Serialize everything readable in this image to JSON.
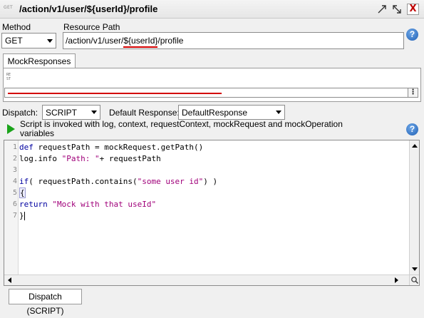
{
  "titlebar": {
    "method_badge": "GET",
    "title": "/action/v1/user/${userId}/profile",
    "close_label": "X"
  },
  "method": {
    "label": "Method",
    "value": "GET"
  },
  "resource_path": {
    "label": "Resource Path",
    "prefix": "/action/v1/user/",
    "param": "${userId}",
    "suffix": "/profile"
  },
  "mock_panel": {
    "tab_label": "MockResponses",
    "rest_icon_text": "RE ST"
  },
  "dispatch": {
    "label": "Dispatch:",
    "value": "SCRIPT",
    "default_response_label": "Default Response:",
    "default_response_value": "DefaultResponse"
  },
  "script_info": {
    "line1": "Script is invoked with log, context, requestContext, mockRequest and mockOperation",
    "line2": "variables"
  },
  "editor": {
    "line_numbers": [
      "1",
      "2",
      "3",
      "4",
      "5",
      "6",
      "7"
    ],
    "lines": [
      {
        "kw": "def",
        "code": " requestPath = mockRequest.getPath()",
        "str": ""
      },
      {
        "kw": "",
        "code": "log.info ",
        "str": "\"Path: \"",
        "rest": "+ requestPath"
      },
      {
        "kw": "",
        "code": "",
        "str": ""
      },
      {
        "kw": "if",
        "code": "( requestPath.contains(",
        "str": "\"some user id\"",
        "rest": ") )"
      },
      {
        "kw": "",
        "code": "{",
        "str": ""
      },
      {
        "kw": "return",
        "code": " ",
        "str": "\"Mock with that useId\""
      },
      {
        "kw": "",
        "code": "}",
        "str": ""
      }
    ]
  },
  "bottom_tab": {
    "label": "Dispatch (SCRIPT)"
  },
  "colors": {
    "accent_red": "#d40000",
    "keyword": "#0000a0",
    "string": "#a0007a",
    "help_blue": "#1f5fb4",
    "run_green": "#1aa31a"
  }
}
